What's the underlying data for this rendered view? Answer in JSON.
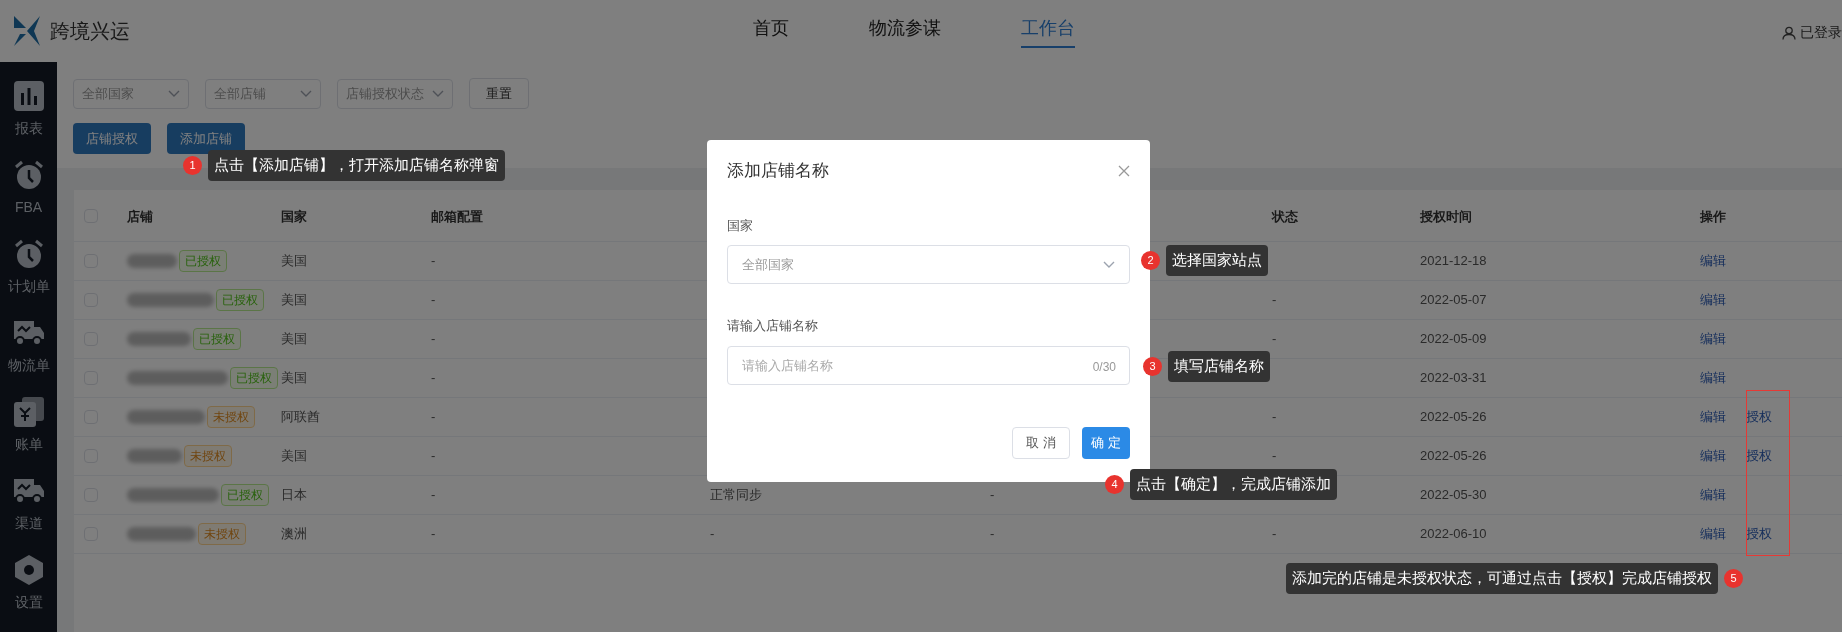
{
  "header": {
    "logo_text": "跨境兴运",
    "nav": [
      {
        "label": "首页",
        "selected": false
      },
      {
        "label": "物流参谋",
        "selected": false
      },
      {
        "label": "工作台",
        "selected": true
      }
    ],
    "user": "已登录"
  },
  "sidebar": {
    "items": [
      {
        "label": "报表",
        "kind": "chart"
      },
      {
        "label": "FBA",
        "kind": "alarm"
      },
      {
        "label": "计划单",
        "kind": "alarm"
      },
      {
        "label": "物流单",
        "kind": "truck"
      },
      {
        "label": "账单",
        "kind": "bill"
      },
      {
        "label": "渠道",
        "kind": "truck"
      },
      {
        "label": "设置",
        "kind": "hexagon"
      }
    ]
  },
  "filters": [
    {
      "placeholder": "全部国家"
    },
    {
      "placeholder": "全部店铺"
    },
    {
      "placeholder": "店铺授权状态"
    }
  ],
  "reset_button": "重置",
  "buttons": [
    "店铺授权",
    "添加店铺"
  ],
  "table": {
    "header_checked": false,
    "columns": [
      {
        "label": "店铺"
      },
      {
        "label": "国家"
      },
      {
        "label": "邮箱配置"
      },
      {},
      {},
      {
        "label": "状态"
      },
      {
        "label": "授权时间"
      },
      {
        "label": "操作"
      }
    ],
    "rows": [
      {
        "checked": false,
        "tag": {
          "label": "已授权",
          "authorized": true
        },
        "country": "美国",
        "email_config": "-",
        "auth_time": "2021-12-18",
        "actions": [
          "编辑"
        ]
      },
      {
        "checked": false,
        "tag": {
          "label": "已授权",
          "authorized": true
        },
        "country": "美国",
        "email_config": "-",
        "status": "-",
        "auth_time": "2022-05-07",
        "actions": [
          "编辑"
        ]
      },
      {
        "checked": false,
        "tag": {
          "label": "已授权",
          "authorized": true
        },
        "country": "美国",
        "email_config": "-",
        "status": "-",
        "auth_time": "2022-05-09",
        "actions": [
          "编辑"
        ]
      },
      {
        "checked": false,
        "tag": {
          "label": "已授权",
          "authorized": true
        },
        "country": "美国",
        "email_config": "-",
        "auth_time": "2022-03-31",
        "actions": [
          "编辑"
        ]
      },
      {
        "checked": false,
        "tag": {
          "label": "未授权",
          "authorized": false
        },
        "country": "阿联酋",
        "email_config": "-",
        "status": "-",
        "auth_time": "2022-05-26",
        "actions": [
          "编辑",
          "授权"
        ]
      },
      {
        "checked": false,
        "tag": {
          "label": "未授权",
          "authorized": false
        },
        "country": "美国",
        "email_config": "-",
        "status": "-",
        "auth_time": "2022-05-26",
        "actions": [
          "编辑",
          "授权"
        ]
      },
      {
        "checked": false,
        "tag": {
          "label": "已授权",
          "authorized": true
        },
        "country": "日本",
        "email_config": "-",
        "column_4": "正常同步",
        "column_5": "-",
        "auth_time": "2022-05-30",
        "actions": [
          "编辑"
        ]
      },
      {
        "checked": false,
        "tag": {
          "label": "未授权",
          "authorized": false
        },
        "country": "澳洲",
        "email_config": "-",
        "column_4": "-",
        "column_5": "-",
        "status": "-",
        "auth_time": "2022-06-10",
        "actions": [
          "编辑",
          "授权"
        ]
      }
    ]
  },
  "modal": {
    "title": "添加店铺名称",
    "country_label": "国家",
    "country_placeholder": "全部国家",
    "name_label": "请输入店铺名称",
    "name_placeholder": "请输入店铺名称",
    "counter": "0/30",
    "cancel": "取 消",
    "ok": "确 定"
  },
  "annotations": [
    {
      "number": "1",
      "text": "点击【添加店铺】，打开添加店铺名称弹窗"
    },
    {
      "number": "2",
      "text": "选择国家站点"
    },
    {
      "number": "3",
      "text": "填写店铺名称"
    },
    {
      "number": "4",
      "text": "点击【确定】，完成店铺添加"
    },
    {
      "number": "5",
      "text": "添加完的店铺是未授权状态，可通过点击【授权】完成店铺授权"
    }
  ]
}
